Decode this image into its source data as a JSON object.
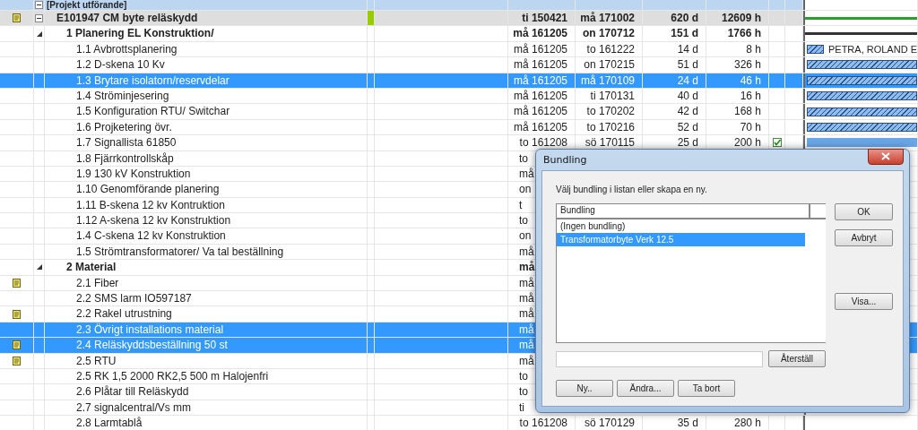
{
  "tasks": [
    {
      "kind": "group",
      "name": "[Projekt utförande]",
      "selected": false,
      "expanded": true,
      "children": [
        {
          "kind": "project",
          "name": "E101947 CM byte reläskydd",
          "selected": false,
          "expanded": true,
          "note": true,
          "marker": true,
          "start": "ti 150421",
          "finish": "må 171002",
          "duration": "620 d",
          "work": "12609 h",
          "bar": {
            "kind": "summary-green"
          },
          "children": [
            {
              "kind": "summary",
              "name": "1  Planering EL Konstruktion/",
              "selected": false,
              "expanded": true,
              "start": "må 161205",
              "finish": "on 170712",
              "duration": "151 d",
              "work": "1766 h",
              "bar": {
                "kind": "summary"
              },
              "children": [
                {
                  "kind": "task",
                  "name": "1.1  Avbrottsplanering",
                  "selected": false,
                  "start": "må 161205",
                  "finish": "to 161222",
                  "duration": "14 d",
                  "work": "8 h",
                  "bar": {
                    "kind": "short"
                  },
                  "resource": "PETRA, ROLAND E"
                },
                {
                  "kind": "task",
                  "name": "1.2  D-skena 10 Kv",
                  "selected": false,
                  "start": "må 161205",
                  "finish": "on 170215",
                  "duration": "51 d",
                  "work": "326 h",
                  "bar": {
                    "kind": "long"
                  }
                },
                {
                  "kind": "task",
                  "name": "1.3  Brytare isolatorn/reservdelar",
                  "selected": true,
                  "start": "må 161205",
                  "finish": "må 170109",
                  "duration": "24 d",
                  "work": "46 h",
                  "bar": {
                    "kind": "long"
                  }
                },
                {
                  "kind": "task",
                  "name": "1.4  Ströminjesering",
                  "selected": false,
                  "start": "må 161205",
                  "finish": "ti 170131",
                  "duration": "40 d",
                  "work": "16 h",
                  "bar": {
                    "kind": "long"
                  }
                },
                {
                  "kind": "task",
                  "name": "1.5  Konfiguration RTU/ Switchar",
                  "selected": false,
                  "start": "må 161205",
                  "finish": "to 170202",
                  "duration": "42 d",
                  "work": "168 h",
                  "bar": {
                    "kind": "long"
                  }
                },
                {
                  "kind": "task",
                  "name": "1.6  Projketering övr.",
                  "selected": false,
                  "start": "må 161205",
                  "finish": "to 170216",
                  "duration": "52 d",
                  "work": "70 h",
                  "bar": {
                    "kind": "long"
                  }
                },
                {
                  "kind": "task",
                  "name": "1.7  Signallista 61850",
                  "selected": false,
                  "done": true,
                  "start": "to 161208",
                  "finish": "sö 170115",
                  "duration": "25 d",
                  "work": "200 h",
                  "bar": {
                    "kind": "solid"
                  }
                },
                {
                  "kind": "task",
                  "name": "1.8  Fjärrkontrollskåp",
                  "selected": false,
                  "covered": true,
                  "start": "to"
                },
                {
                  "kind": "task",
                  "name": "1.9  130 kV Konstruktion",
                  "selected": false,
                  "covered": true,
                  "start": "må"
                },
                {
                  "kind": "task",
                  "name": "1.10  Genomförande planering",
                  "selected": false,
                  "covered": true,
                  "start": "on"
                },
                {
                  "kind": "task",
                  "name": "1.11  B-skena 12 kv Kontruktion",
                  "selected": false,
                  "covered": true,
                  "start": "t"
                },
                {
                  "kind": "task",
                  "name": "1.12  A-skena 12 kv Konstruktion",
                  "selected": false,
                  "covered": true,
                  "start": "to"
                },
                {
                  "kind": "task",
                  "name": "1.4  C-skena 12 kv Konstruktion",
                  "selected": false,
                  "covered": true,
                  "start": "on"
                },
                {
                  "kind": "task",
                  "name": "1.5  Strömtransformatorer/ Va tal beställning",
                  "selected": false,
                  "covered": true,
                  "start": "må"
                }
              ]
            },
            {
              "kind": "summary",
              "name": "2  Material",
              "selected": false,
              "expanded": true,
              "covered": true,
              "start": "må",
              "children": [
                {
                  "kind": "task",
                  "name": "2.1  Fiber",
                  "selected": false,
                  "note": true,
                  "covered": true,
                  "start": "må"
                },
                {
                  "kind": "task",
                  "name": "2.2  SMS larm IO597187",
                  "selected": false,
                  "covered": true,
                  "start": "må"
                },
                {
                  "kind": "task",
                  "name": "2.2  Rakel utrustning",
                  "selected": false,
                  "note": true,
                  "covered": true,
                  "start": "må"
                },
                {
                  "kind": "task",
                  "name": "2.3  Övrigt installations material",
                  "selected": true,
                  "covered": true,
                  "start": "må"
                },
                {
                  "kind": "task",
                  "name": "2.4  Reläskyddsbeställning 50 st",
                  "selected": true,
                  "note": true,
                  "covered": true,
                  "start": "må"
                },
                {
                  "kind": "task",
                  "name": "2.5  RTU",
                  "selected": false,
                  "note": true,
                  "covered": true,
                  "start": "må"
                },
                {
                  "kind": "task",
                  "name": "2.5  RK 1,5 2000 RK2,5 500 m Halojenfri",
                  "selected": false,
                  "covered": true,
                  "start": "to"
                },
                {
                  "kind": "task",
                  "name": "2.6  Plåtar till Reläskydd",
                  "selected": false,
                  "covered": true,
                  "start": "to"
                },
                {
                  "kind": "task",
                  "name": "2.7  signalcentral/Vs mm",
                  "selected": false,
                  "covered": true,
                  "start": "ti"
                },
                {
                  "kind": "task",
                  "name": "2.8  Larmtablå",
                  "selected": false,
                  "start": "to 161208",
                  "finish": "sö 170129",
                  "duration": "35 d",
                  "work": "280 h"
                }
              ]
            }
          ]
        }
      ]
    }
  ],
  "dialog": {
    "title": "Bundling",
    "instruction": "Välj bundling i listan eller skapa en ny.",
    "list_header": "Bundling",
    "items": [
      {
        "label": "(Ingen bundling)",
        "selected": false
      },
      {
        "label": "Transformatorbyte Verk 12.5",
        "selected": true
      }
    ],
    "side_buttons": [
      "OK",
      "Avbryt"
    ],
    "view_button": "Visa...",
    "reset_button": "Återställ",
    "bottom_buttons": [
      "Ny..",
      "Ändra...",
      "Ta bort"
    ]
  }
}
